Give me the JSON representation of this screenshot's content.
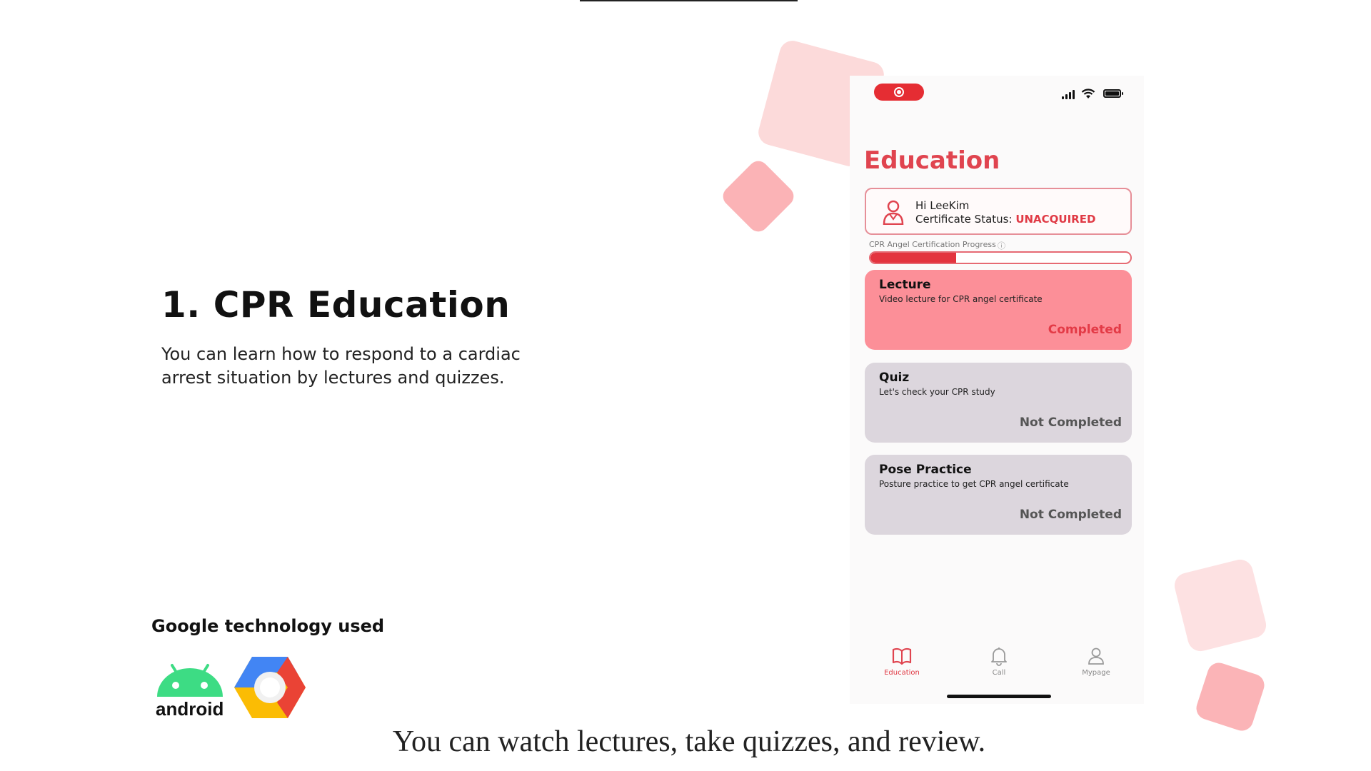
{
  "slide": {
    "title": "1. CPR Education",
    "description": "You can learn how to respond to a cardiac arrest situation by lectures and quizzes.",
    "google_label": "Google technology used",
    "android_text": "android",
    "caption": "You can watch lectures, take quizzes, and review."
  },
  "app": {
    "title": "Education",
    "greeting": "Hi LeeKim",
    "certificate_label": "Certificate Status: ",
    "certificate_status": "UNACQUIRED",
    "progress_label": "CPR Angel Certification Progress",
    "progress_value": 0.33,
    "accent_color": "#e0444f",
    "cards": [
      {
        "title": "Lecture",
        "subtitle": "Video lecture for CPR angel certificate",
        "status": "Completed"
      },
      {
        "title": "Quiz",
        "subtitle": "Let's check your CPR study",
        "status": "Not Completed"
      },
      {
        "title": "Pose Practice",
        "subtitle": "Posture practice to get CPR angel certificate",
        "status": "Not Completed"
      }
    ],
    "nav": [
      {
        "label": "Education",
        "icon": "book-icon",
        "active": true
      },
      {
        "label": "Call",
        "icon": "bell-icon",
        "active": false
      },
      {
        "label": "Mypage",
        "icon": "user-icon",
        "active": false
      }
    ]
  }
}
